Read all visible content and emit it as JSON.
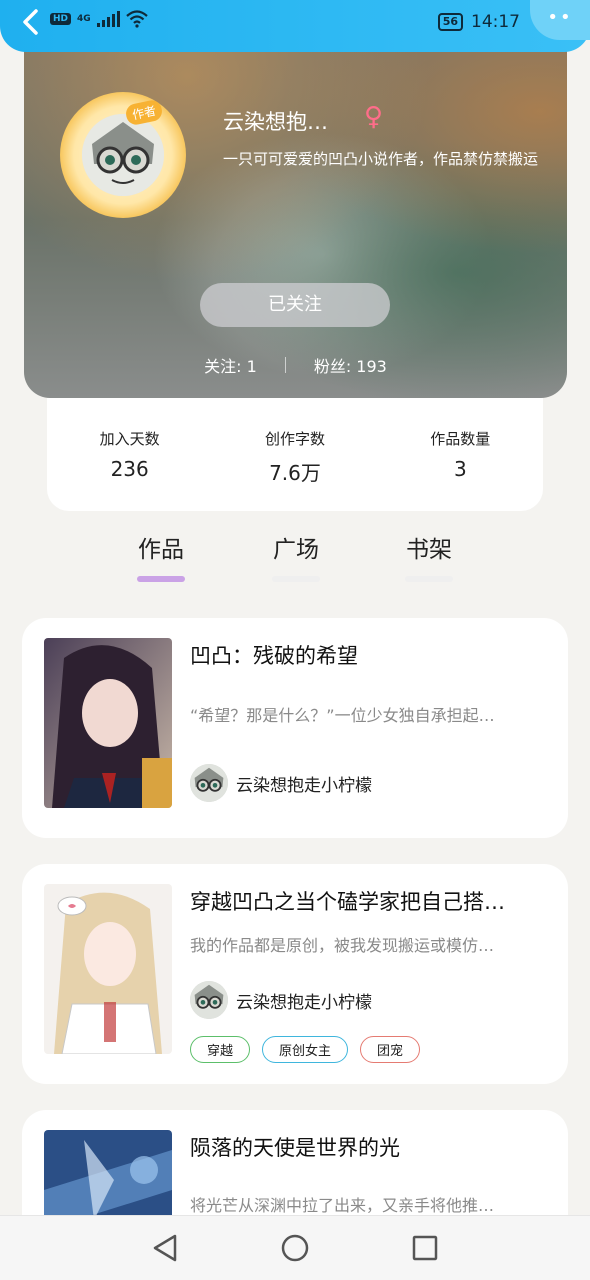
{
  "status_bar": {
    "network": "HD",
    "net_type": "4G",
    "battery": "56",
    "time": "14:17",
    "more": "••"
  },
  "profile": {
    "author_tag": "作者",
    "nickname": "云染想抱…",
    "gender_symbol": "♀",
    "bio": "一只可可爱爱的凹凸小说作者，作品禁仿禁搬运",
    "follow_button": "已关注",
    "following_label": "关注: 1",
    "fans_label": "粉丝: 193"
  },
  "stats": [
    {
      "label": "加入天数",
      "value": "236"
    },
    {
      "label": "创作字数",
      "value": "7.6万"
    },
    {
      "label": "作品数量",
      "value": "3"
    }
  ],
  "tabs": [
    {
      "label": "作品",
      "active": true
    },
    {
      "label": "广场",
      "active": false
    },
    {
      "label": "书架",
      "active": false
    }
  ],
  "works": [
    {
      "title": "凹凸：残破的希望",
      "desc": "“希望？那是什么？”一位少女独自承担起…",
      "author": "云染想抱走小柠檬",
      "tags": []
    },
    {
      "title": "穿越凹凸之当个磕学家把自己搭…",
      "desc": "我的作品都是原创，被我发现搬运或模仿…",
      "author": "云染想抱走小柠檬",
      "tags": [
        {
          "label": "穿越",
          "color": "#5cbf6a"
        },
        {
          "label": "原创女主",
          "color": "#3fb6dd"
        },
        {
          "label": "团宠",
          "color": "#e57b72"
        }
      ]
    },
    {
      "title": "陨落的天使是世界的光",
      "desc": "将光芒从深渊中拉了出来，又亲手将他推…",
      "author": "",
      "tags": []
    }
  ],
  "colors": {
    "status_bar": "#1fb0ef",
    "active_tab_underline": "#caa2e6",
    "gender": "#ff6d8a"
  }
}
